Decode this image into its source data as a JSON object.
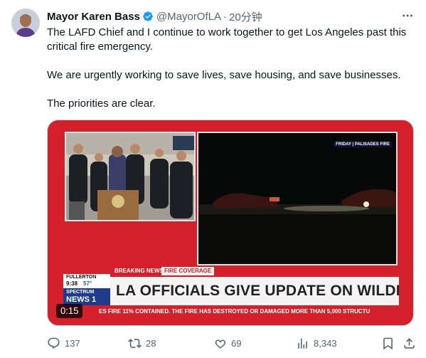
{
  "tweet": {
    "author_name": "Mayor Karen Bass",
    "handle": "@MayorOfLA",
    "separator": "·",
    "time": "20分钟",
    "paragraphs": [
      "The LAFD Chief and I continue to work together to get Los Angeles past this critical fire emergency.",
      "We are urgently working to save lives, save housing, and save businesses.",
      "The priorities are clear."
    ]
  },
  "video": {
    "breaking_news_label": "BREAKING NEWS",
    "fire_coverage_label": "FIRE COVERAGE",
    "headline": "LA OFFICIALS GIVE UPDATE ON WILDFIRES",
    "location_city": "FULLERTON",
    "location_time": "9:38",
    "location_temp": "57°",
    "network_line1": "SPECTRUM",
    "network_line2": "NEWS 1",
    "ticker": "ES FIRE 11% CONTAINED. THE FIRE HAS DESTROYED OR DAMAGED MORE THAN 5,000 STRUCTU",
    "right_feed_label": "FRIDAY | PALISADES FIRE",
    "duration": "0:15"
  },
  "actions": {
    "replies": "137",
    "retweets": "28",
    "likes": "69",
    "views": "8,343"
  },
  "colors": {
    "verified_badge": "#1d9bf0",
    "news_red": "#d4202a",
    "muted_text": "#536471"
  }
}
